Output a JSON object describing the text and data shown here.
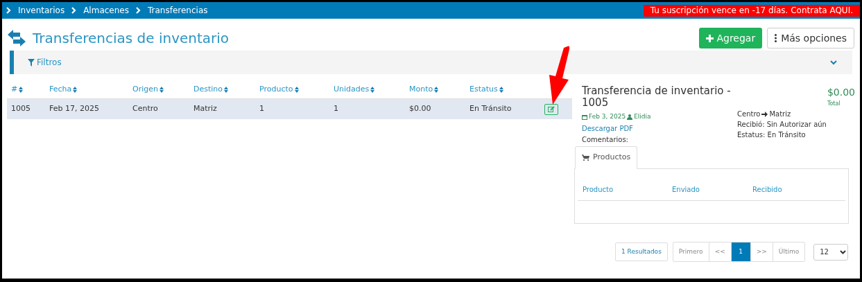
{
  "breadcrumb": [
    "Inventarios",
    "Almacenes",
    "Transferencias"
  ],
  "subscription_notice": "Tu suscripción vence en -17 días. Contrata AQUI.",
  "page_title": "Transferencias de inventario",
  "buttons": {
    "add": "Agregar",
    "more": "Más opciones"
  },
  "filters": {
    "label": "Filtros",
    "expanded": false
  },
  "table": {
    "columns": [
      "#",
      "Fecha",
      "Origen",
      "Destino",
      "Producto",
      "Unidades",
      "Monto",
      "Estatus"
    ],
    "rows": [
      {
        "cells": [
          "1005",
          "Feb 17, 2025",
          "Centro",
          "Matriz",
          "1",
          "1",
          "$0.00",
          "En Tránsito"
        ],
        "selected": true
      }
    ]
  },
  "detail": {
    "title": "Transferencia de inventario - 1005",
    "date": "Feb 3, 2025",
    "user": "Elidia",
    "download": "Descargar PDF",
    "comments": "Comentarios:",
    "total": "$0.00",
    "total_label": "Total",
    "origin": "Centro",
    "destination": "Matriz",
    "received": "Recibió: Sin Autorizar aún",
    "status": "Estatus: En Tránsito",
    "tabs": [
      {
        "label": "Productos",
        "selected": true
      }
    ],
    "product_columns": [
      "Producto",
      "Enviado",
      "Recibido"
    ]
  },
  "pagination": {
    "results": "1 Resultados",
    "pages": [
      {
        "label": "Primero",
        "selected": false
      },
      {
        "label": "<<",
        "selected": false
      },
      {
        "label": "1",
        "selected": true
      },
      {
        "label": ">>",
        "selected": false
      },
      {
        "label": "Último",
        "selected": false
      }
    ],
    "page_size": "12"
  }
}
